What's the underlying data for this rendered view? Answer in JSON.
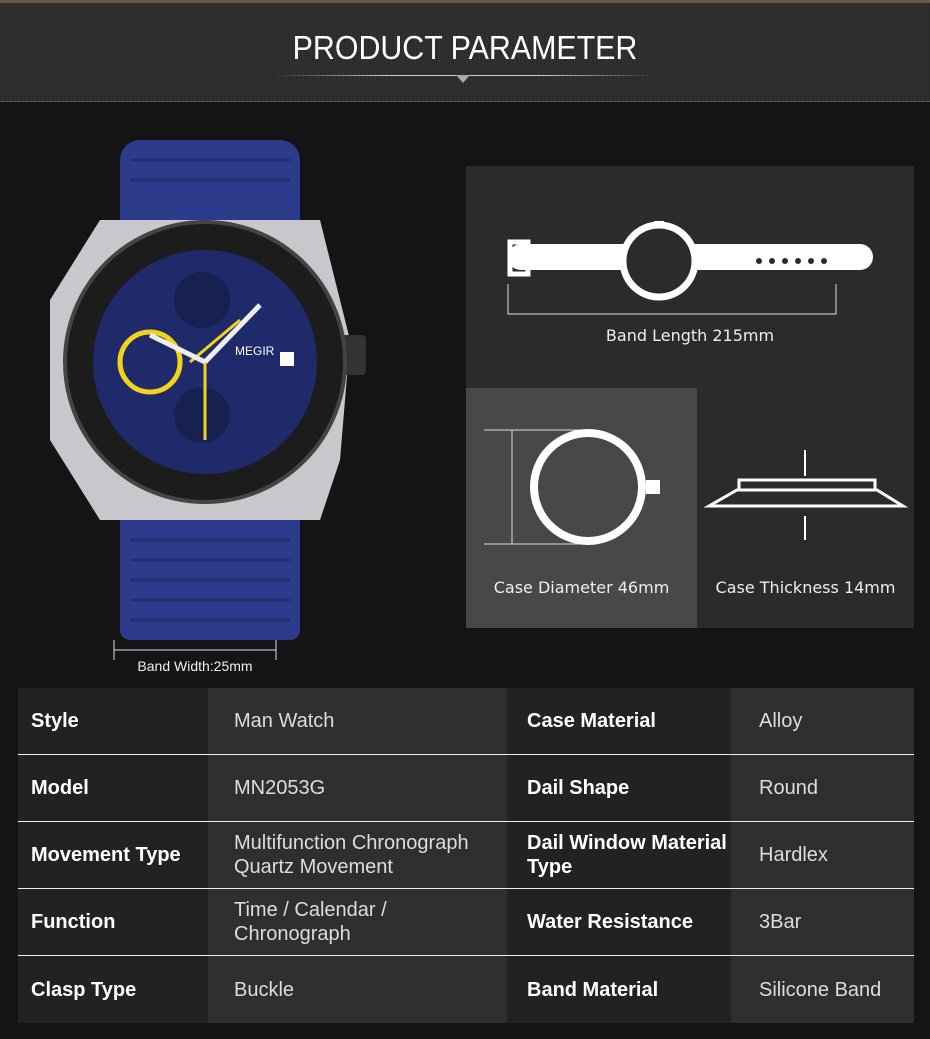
{
  "header": {
    "title": "PRODUCT PARAMETER"
  },
  "watch": {
    "brand": "MEGIR",
    "band_width": "Band Width:25mm",
    "colors": {
      "band": "#2e3a8c",
      "dial": "#1e2a6a",
      "accent": "#f2d31c"
    }
  },
  "dimensions": {
    "band_length": "Band Length 215mm",
    "case_diameter": "Case Diameter 46mm",
    "case_thickness": "Case Thickness 14mm"
  },
  "specs": [
    {
      "label1": "Style",
      "value1": "Man Watch",
      "label2": "Case Material",
      "value2": "Alloy"
    },
    {
      "label1": "Model",
      "value1": "MN2053G",
      "label2": "Dail Shape",
      "value2": "Round"
    },
    {
      "label1": "Movement Type",
      "value1": "Multifunction Chronograph Quartz Movement",
      "label2": "Dail Window Material Type",
      "value2": "Hardlex"
    },
    {
      "label1": "Function",
      "value1": "Time  / Calendar / Chronograph",
      "label2": "Water Resistance",
      "value2": "3Bar"
    },
    {
      "label1": "Clasp Type",
      "value1": "Buckle",
      "label2": "Band Material",
      "value2": "Silicone Band"
    }
  ]
}
